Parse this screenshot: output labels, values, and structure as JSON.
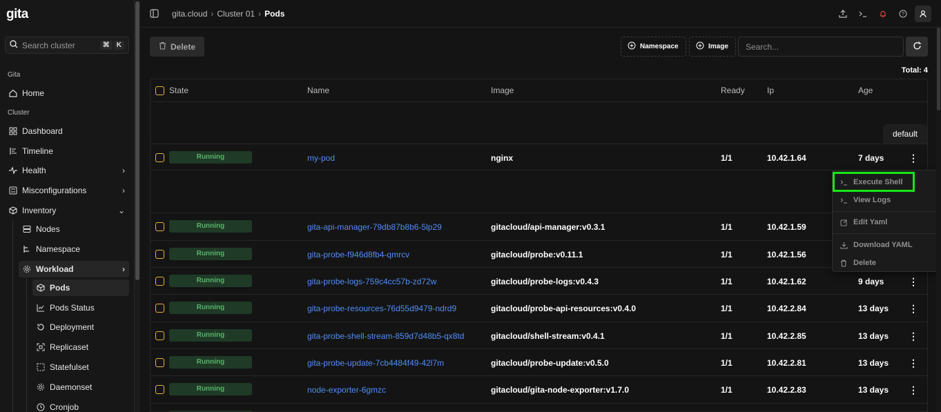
{
  "app": {
    "logo": "gita"
  },
  "sidebar": {
    "search_placeholder": "Search cluster",
    "search_shortcut_cmd": "⌘",
    "search_shortcut_key": "K",
    "section_gita": "Gita",
    "section_cluster": "Cluster",
    "items": {
      "home": "Home",
      "dashboard": "Dashboard",
      "timeline": "Timeline",
      "health": "Health",
      "misconfigurations": "Misconfigurations",
      "inventory": "Inventory",
      "nodes": "Nodes",
      "namespace": "Namespace",
      "workload": "Workload",
      "pods": "Pods",
      "pods_status": "Pods Status",
      "deployment": "Deployment",
      "replicaset": "Replicaset",
      "statefulset": "Statefulset",
      "daemonset": "Daemonset",
      "cronjob": "Cronjob"
    }
  },
  "header": {
    "breadcrumb": [
      "gita.cloud",
      "Cluster 01",
      "Pods"
    ]
  },
  "toolbar": {
    "delete_label": "Delete",
    "namespace_filter": "Namespace",
    "image_filter": "Image",
    "search_placeholder": "Search...",
    "total_label": "Total: 4"
  },
  "table": {
    "columns": {
      "state": "State",
      "name": "Name",
      "image": "Image",
      "ready": "Ready",
      "ip": "Ip",
      "age": "Age"
    },
    "namespace_tab": "default",
    "rows": [
      {
        "state": "Running",
        "name": "my-pod",
        "image": "nginx",
        "ready": "1/1",
        "ip": "10.42.1.64",
        "age": "7 days"
      },
      {
        "state": "Running",
        "name": "gita-api-manager-79db87b8b6-5lp29",
        "image": "gitacloud/api-manager:v0.3.1",
        "ready": "1/1",
        "ip": "10.42.1.59",
        "age": ""
      },
      {
        "state": "Running",
        "name": "gita-probe-f946d8fb4-qmrcv",
        "image": "gitacloud/probe:v0.11.1",
        "ready": "1/1",
        "ip": "10.42.1.56",
        "age": ""
      },
      {
        "state": "Running",
        "name": "gita-probe-logs-759c4cc57b-zd72w",
        "image": "gitacloud/probe-logs:v0.4.3",
        "ready": "1/1",
        "ip": "10.42.1.62",
        "age": "9 days"
      },
      {
        "state": "Running",
        "name": "gita-probe-resources-76d55d9479-ndrd9",
        "image": "gitacloud/probe-api-resources:v0.4.0",
        "ready": "1/1",
        "ip": "10.42.2.84",
        "age": "13 days"
      },
      {
        "state": "Running",
        "name": "gita-probe-shell-stream-859d7d48b5-qx8td",
        "image": "gitacloud/shell-stream:v0.4.1",
        "ready": "1/1",
        "ip": "10.42.2.85",
        "age": "13 days"
      },
      {
        "state": "Running",
        "name": "gita-probe-update-7cb4484f49-42l7m",
        "image": "gitacloud/probe-update:v0.5.0",
        "ready": "1/1",
        "ip": "10.42.2.81",
        "age": "13 days"
      },
      {
        "state": "Running",
        "name": "node-exporter-6gmzc",
        "image": "gitacloud/gita-node-exporter:v1.7.0",
        "ready": "1/1",
        "ip": "10.42.2.83",
        "age": "13 days"
      }
    ]
  },
  "context_menu": {
    "execute_shell": "Execute Shell",
    "view_logs": "View Logs",
    "edit_yaml": "Edit Yaml",
    "download_yaml": "Download YAML",
    "delete": "Delete"
  },
  "colors": {
    "accent_link": "#4f8ef7",
    "running_bg": "#1f3a27",
    "running_text": "#58b36a",
    "checkbox": "#e1b43a",
    "highlight": "#17e617"
  }
}
